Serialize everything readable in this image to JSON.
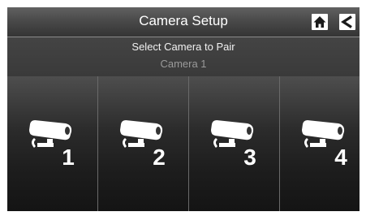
{
  "header": {
    "title": "Camera Setup",
    "home_icon": "home-icon",
    "back_icon": "back-arrow-icon"
  },
  "subbar": {
    "prompt": "Select Camera to Pair",
    "selected": "Camera 1"
  },
  "cameras": [
    {
      "number": "1",
      "icon": "security-camera-icon"
    },
    {
      "number": "2",
      "icon": "security-camera-icon"
    },
    {
      "number": "3",
      "icon": "security-camera-icon"
    },
    {
      "number": "4",
      "icon": "security-camera-icon"
    }
  ]
}
